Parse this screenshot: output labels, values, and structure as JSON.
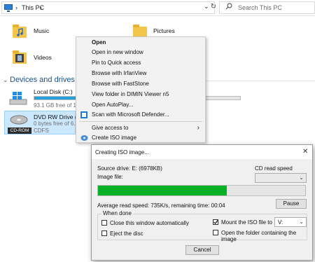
{
  "address": {
    "crumb_sep": "›",
    "location": "This PC",
    "dropdown": "⌄",
    "refresh": "↻",
    "search_placeholder": "Search This PC"
  },
  "folders": [
    {
      "label": "Music"
    },
    {
      "label": "Pictures"
    },
    {
      "label": "Videos"
    }
  ],
  "devices_header": "Devices and drives (3",
  "drives": [
    {
      "name": "Local Disk (C:)",
      "free": "93.1 GB free of 19",
      "used_fraction": 0.52
    },
    {
      "name": "DVD RW Drive (E",
      "free": "0 bytes free of 6.",
      "fs": "CDFS",
      "badge": "CD-ROM"
    }
  ],
  "context_menu": {
    "items": [
      {
        "label": "Open",
        "bold": true
      },
      {
        "label": "Open in new window"
      },
      {
        "label": "Pin to Quick access"
      },
      {
        "label": "Browse with IrfanView"
      },
      {
        "label": "Browse with FastStone"
      },
      {
        "label": "View folder in DIMIN Viewer n5"
      },
      {
        "label": "Open AutoPlay..."
      },
      {
        "label": "Scan with Microsoft Defender..."
      },
      {
        "label": "Give access to",
        "submenu": "›"
      },
      {
        "label": "Create ISO image"
      }
    ]
  },
  "dialog": {
    "title": "Creating ISO image...",
    "close": "✕",
    "source_drive": "Source drive: E: (6978KB)",
    "image_file_label": "Image file:",
    "cd_read_speed_label": "CD read speed",
    "progress_fraction": 0.62,
    "status": "Average read speed: 735K/s, remaining time: 00:04",
    "pause_label": "Pause",
    "when_done_label": "When done",
    "close_window_label": "Close this window automatically",
    "close_window_checked": false,
    "mount_label": "Mount the ISO file to",
    "mount_checked": true,
    "mount_drive": "V:",
    "eject_label": "Eject the disc",
    "eject_checked": false,
    "open_folder_label": "Open the folder containing the image",
    "open_folder_checked": false,
    "cancel_label": "Cancel"
  },
  "colors": {
    "progress": "#06b025",
    "accent": "#26a0da",
    "folder": "#f3c64b"
  }
}
